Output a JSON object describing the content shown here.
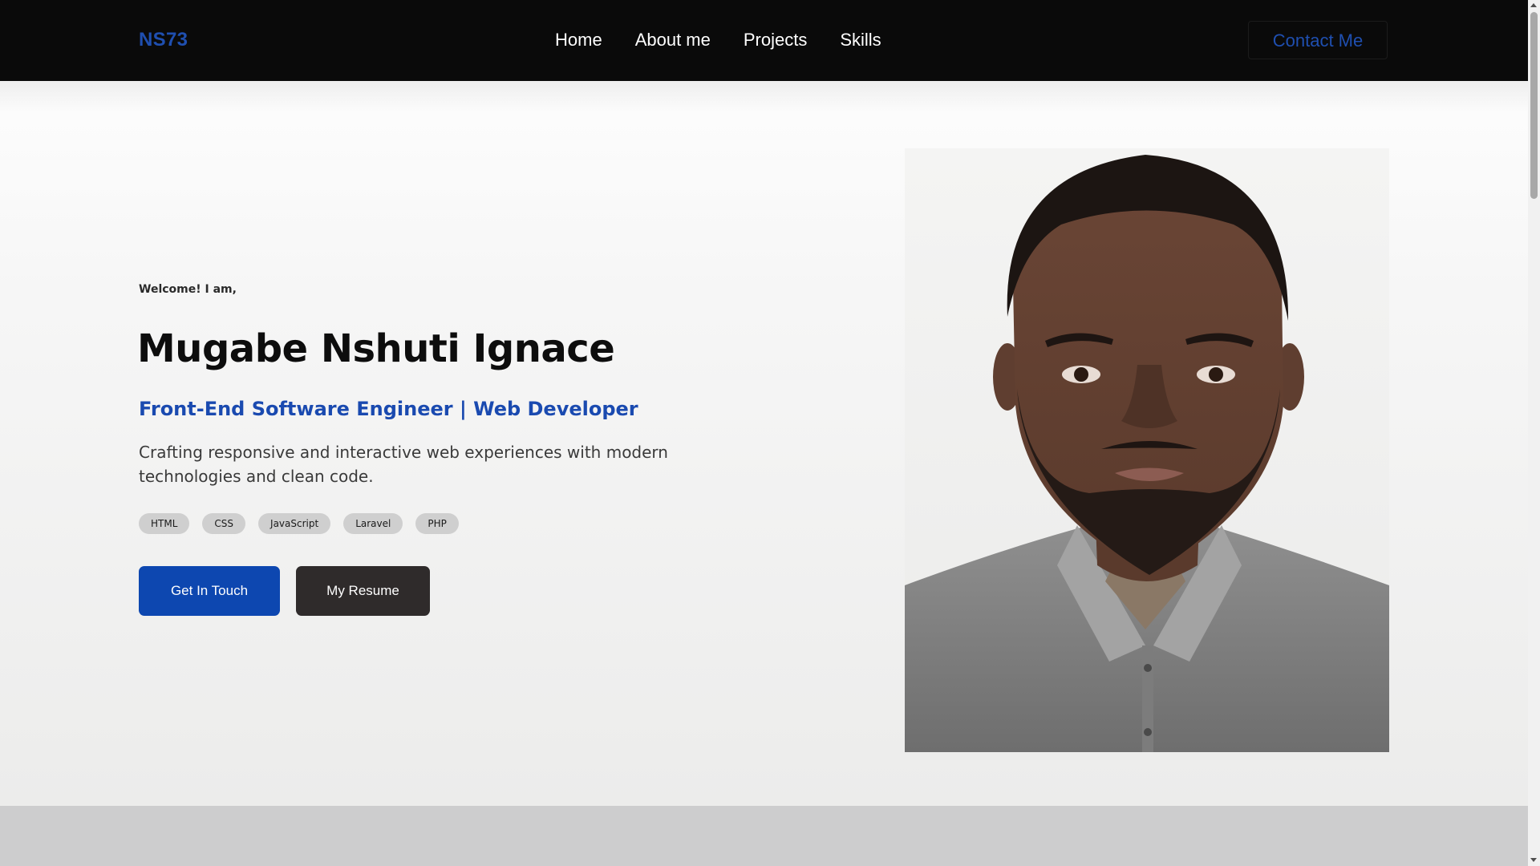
{
  "navbar": {
    "brand": "NS73",
    "links": [
      {
        "label": "Home"
      },
      {
        "label": "About me"
      },
      {
        "label": "Projects"
      },
      {
        "label": "Skills"
      }
    ],
    "contact_label": "Contact Me"
  },
  "hero": {
    "welcome": "Welcome! I am,",
    "name": "Mugabe Nshuti Ignace",
    "role": "Front-End Software Engineer | Web Developer",
    "description": "Crafting responsive and interactive web experiences with modern technologies and clean code.",
    "tags": [
      "HTML",
      "CSS",
      "JavaScript",
      "Laravel",
      "PHP"
    ],
    "primary_button": "Get In Touch",
    "secondary_button": "My Resume"
  },
  "colors": {
    "accent": "#1a4ab0",
    "navbar_bg": "#0a0a0a",
    "secondary_button_bg": "#2f2b2b"
  }
}
